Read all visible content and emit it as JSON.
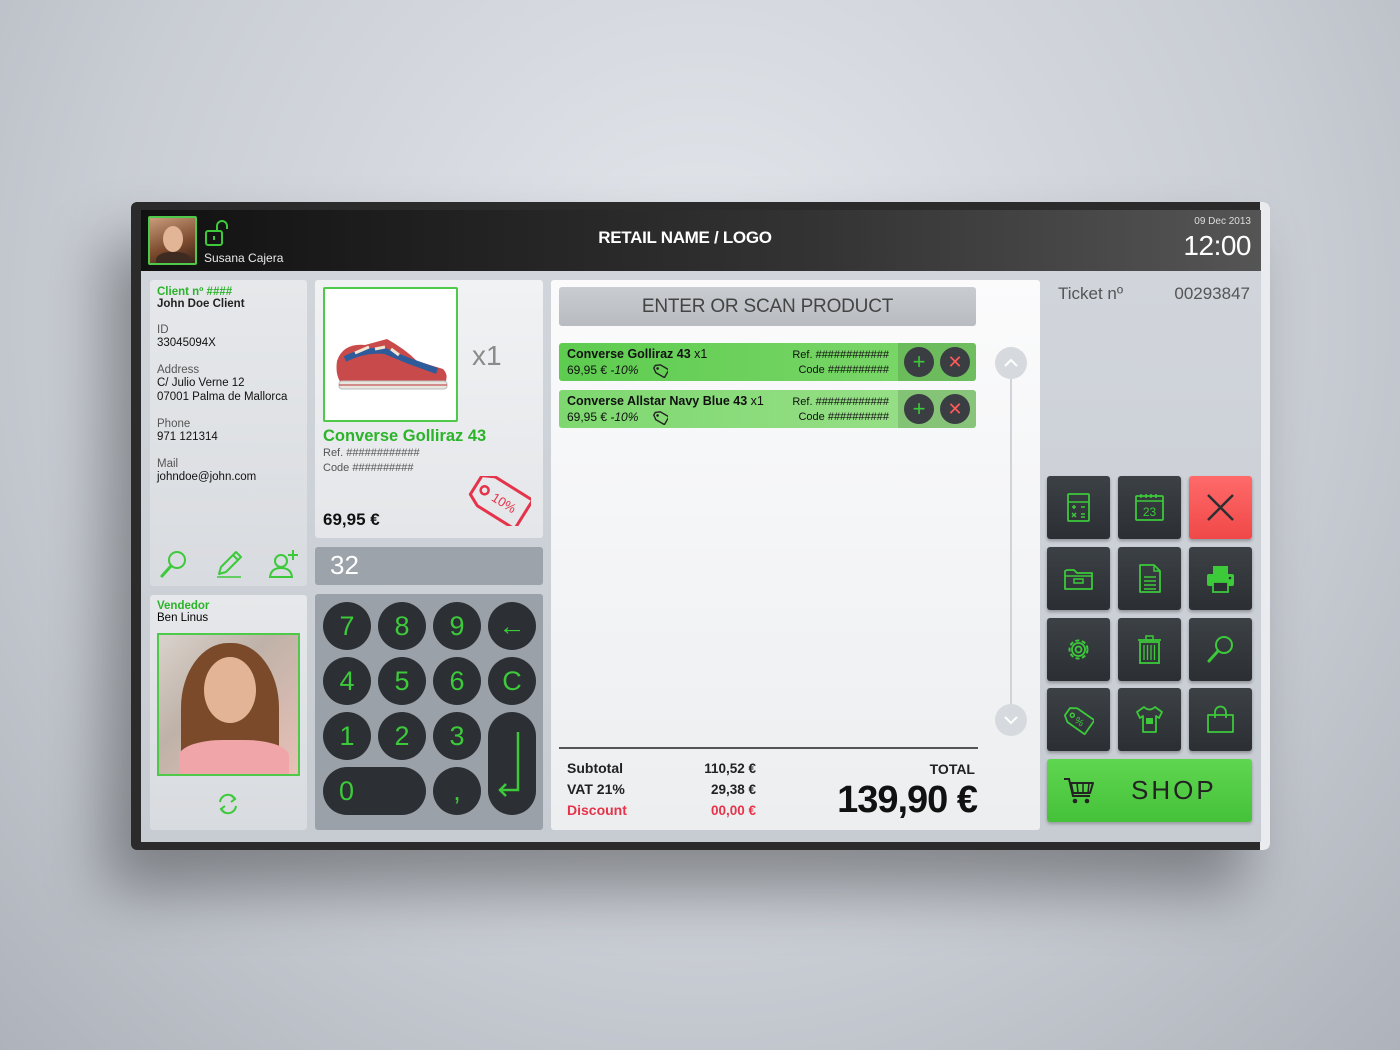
{
  "header": {
    "cashier_name": "Susana Cajera",
    "retail_logo": "RETAIL NAME / LOGO",
    "date": "09 Dec 2013",
    "time": "12:00"
  },
  "client": {
    "number_label": "Client nº ####",
    "name": "John Doe Client",
    "id_label": "ID",
    "id_value": "33045094X",
    "address_label": "Address",
    "address_line1": "C/ Julio Verne 12",
    "address_line2": "07001 Palma de Mallorca",
    "phone_label": "Phone",
    "phone_value": "971 121314",
    "mail_label": "Mail",
    "mail_value": "johndoe@john.com"
  },
  "seller": {
    "label": "Vendedor",
    "name": "Ben Linus"
  },
  "product": {
    "qty": "x1",
    "name": "Converse Golliraz 43",
    "ref": "Ref. ############",
    "code": "Code ##########",
    "price": "69,95 €",
    "discount_tag": "10%"
  },
  "keypad": {
    "display": "32",
    "keys": [
      "7",
      "8",
      "9",
      "←",
      "4",
      "5",
      "6",
      "C",
      "1",
      "2",
      "3",
      "0",
      ","
    ]
  },
  "ticket": {
    "scan_placeholder": "ENTER OR SCAN PRODUCT",
    "items": [
      {
        "name": "Converse Golliraz 43",
        "qty": "x1",
        "price": "69,95 €",
        "discount": "-10%",
        "ref": "Ref. ############",
        "code": "Code ##########"
      },
      {
        "name": "Converse Allstar Navy Blue 43",
        "qty": "x1",
        "price": "69,95 €",
        "discount": "-10%",
        "ref": "Ref. ############",
        "code": "Code ##########"
      }
    ],
    "subtotal_label": "Subtotal",
    "subtotal_value": "110,52 €",
    "vat_label": "VAT 21%",
    "vat_value": "29,38 €",
    "discount_label": "Discount",
    "discount_value": "00,00 €",
    "total_label": "TOTAL",
    "total_value": "139,90 €"
  },
  "right_panel": {
    "ticket_label": "Ticket nº",
    "ticket_number": "00293847",
    "calendar_day": "23",
    "shop_label": "SHOP"
  },
  "colors": {
    "accent_green": "#3cc93a",
    "alert_red": "#f04848",
    "dark_button": "#2b2f33"
  },
  "icons": [
    "lock-open-icon",
    "search-icon",
    "pencil-icon",
    "add-user-icon",
    "refresh-icon",
    "tag-icon",
    "calculator-icon",
    "calendar-icon",
    "close-icon",
    "folder-icon",
    "document-icon",
    "printer-icon",
    "gear-icon",
    "trash-icon",
    "search-icon",
    "discount-tag-icon",
    "shirt-icon",
    "bag-icon",
    "cart-icon"
  ]
}
